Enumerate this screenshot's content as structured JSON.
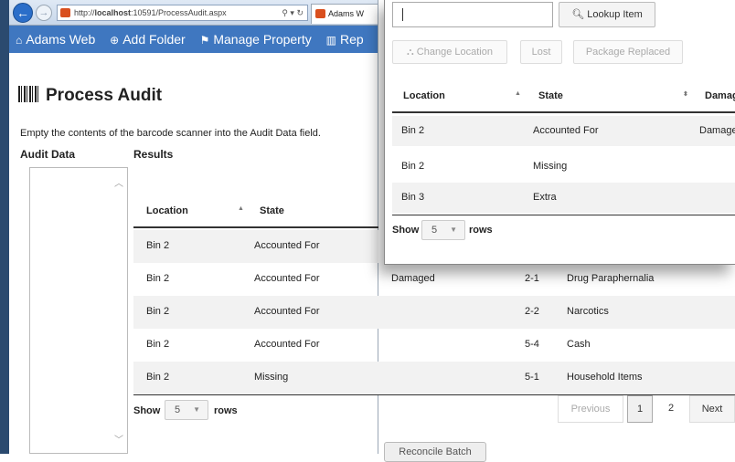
{
  "browser": {
    "url_prefix": "http://",
    "url_host": "localhost",
    "url_path": ":10591/ProcessAudit.aspx",
    "addr_tools": "⚲ ▾ ↻",
    "tab_title": "Adams W"
  },
  "navbar": {
    "items": [
      {
        "icon": "⌂",
        "label": "Adams Web"
      },
      {
        "icon": "⊕",
        "label": "Add Folder"
      },
      {
        "icon": "⚑",
        "label": "Manage Property"
      },
      {
        "icon": "▥",
        "label": "Rep"
      }
    ]
  },
  "page": {
    "title": "Process Audit",
    "instructions": "Empty the contents of the barcode scanner into the Audit Data field.",
    "audit_label": "Audit Data",
    "results_label": "Results"
  },
  "results": {
    "columns": [
      "Location",
      "State"
    ],
    "rows": [
      {
        "location": "Bin 2",
        "state": "Accounted For",
        "damage": "",
        "code": "",
        "category": ""
      },
      {
        "location": "Bin 2",
        "state": "Accounted For",
        "damage": "Damaged",
        "code": "2-1",
        "category": "Drug Paraphernalia"
      },
      {
        "location": "Bin 2",
        "state": "Accounted For",
        "damage": "",
        "code": "2-2",
        "category": "Narcotics"
      },
      {
        "location": "Bin 2",
        "state": "Accounted For",
        "damage": "",
        "code": "5-4",
        "category": "Cash"
      },
      {
        "location": "Bin 2",
        "state": "Missing",
        "damage": "",
        "code": "5-1",
        "category": "Household Items"
      }
    ],
    "show_label": "Show",
    "rows_label": "rows",
    "page_size": "5",
    "pager": {
      "previous": "Previous",
      "page1": "1",
      "page2": "2",
      "next": "Next"
    },
    "reconcile_label": "Reconcile Batch"
  },
  "popup": {
    "lookup_label": "Lookup Item",
    "buttons": {
      "change_location": "Change Location",
      "lost": "Lost",
      "package_replaced": "Package Replaced"
    },
    "columns": [
      "Location",
      "State",
      "Damag"
    ],
    "rows": [
      {
        "location": "Bin 2",
        "state": "Accounted For",
        "damage": "Damage"
      },
      {
        "location": "Bin 2",
        "state": "Missing",
        "damage": ""
      },
      {
        "location": "Bin 3",
        "state": "Extra",
        "damage": ""
      }
    ],
    "show_label": "Show",
    "rows_label": "rows",
    "page_size": "5"
  },
  "colors": {
    "navbar": "#3f77c0",
    "accent": "#2b6ec9"
  }
}
